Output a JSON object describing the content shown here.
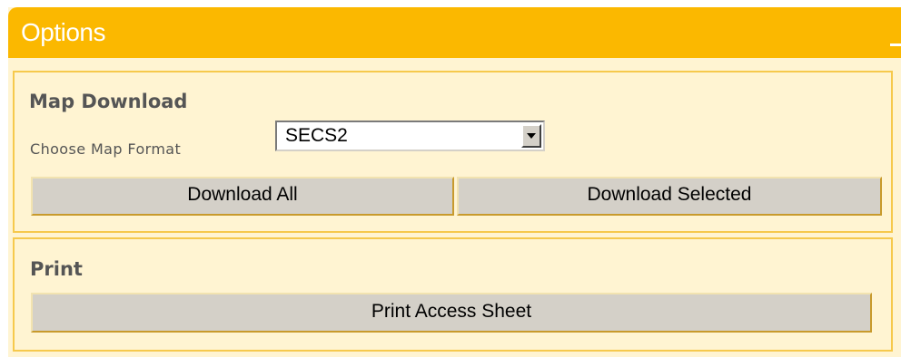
{
  "panel": {
    "title": "Options"
  },
  "map_download": {
    "title": "Map Download",
    "format_label": "Choose Map Format",
    "format_selected": "SECS2",
    "download_all_label": "Download All",
    "download_selected_label": "Download Selected"
  },
  "print": {
    "title": "Print",
    "print_access_sheet_label": "Print Access Sheet"
  },
  "colors": {
    "header": "#fbb800",
    "panel_background": "#fff4d2",
    "fieldset_border": "#f6c94c",
    "button_face": "#d4d0c8",
    "section_text": "#555555"
  },
  "icons": {
    "minimize": "minimize-icon",
    "dropdown": "chevron-down-icon"
  }
}
